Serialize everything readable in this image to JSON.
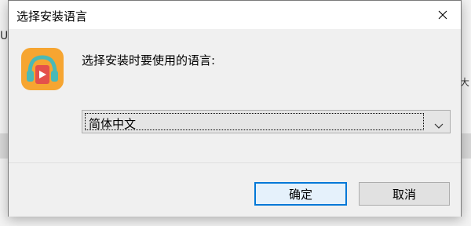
{
  "background": {
    "left_char": "U",
    "right_char": "大"
  },
  "dialog": {
    "title": "选择安装语言",
    "prompt": "选择安装时要使用的语言:",
    "language_select": {
      "selected": "简体中文"
    },
    "buttons": {
      "ok": "确定",
      "cancel": "取消"
    },
    "icons": {
      "app": "headphones-app-icon",
      "close": "close-icon",
      "dropdown": "chevron-down-icon"
    }
  },
  "colors": {
    "accent": "#0078d7",
    "icon_orange": "#f6a531",
    "icon_red": "#e4514b",
    "icon_teal": "#4ab9b6"
  }
}
